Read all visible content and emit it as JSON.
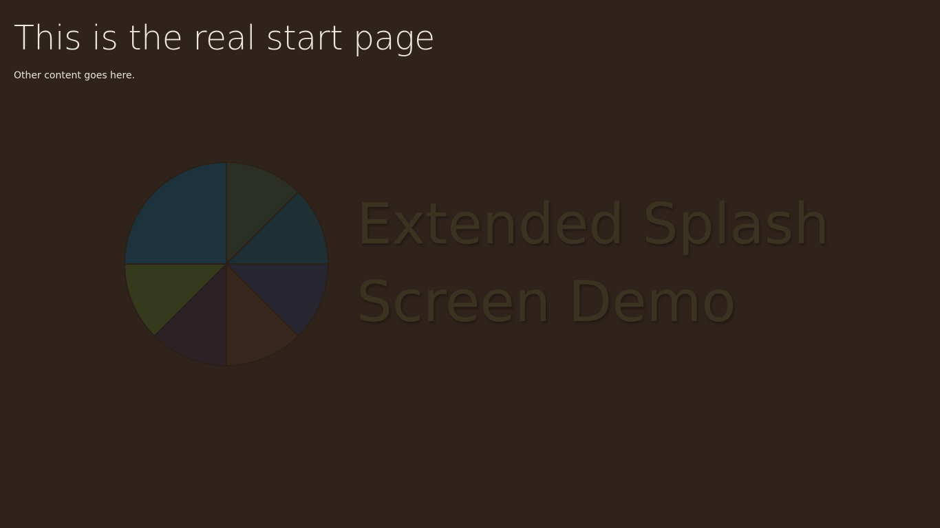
{
  "page": {
    "title": "This is the real start page",
    "subtitle": "Other content goes here."
  },
  "splash": {
    "line1": "Extended Splash",
    "line2": "Screen Demo",
    "logo_colors": [
      "#2b2f25",
      "#1e3033",
      "#272530",
      "#37271c",
      "#2c2124",
      "#353a1d",
      "#1c333d"
    ],
    "logo_divider": "#2a2018"
  },
  "colors": {
    "background": "#30231c",
    "title": "#ece7e0",
    "splash_text": "#3b3321"
  }
}
